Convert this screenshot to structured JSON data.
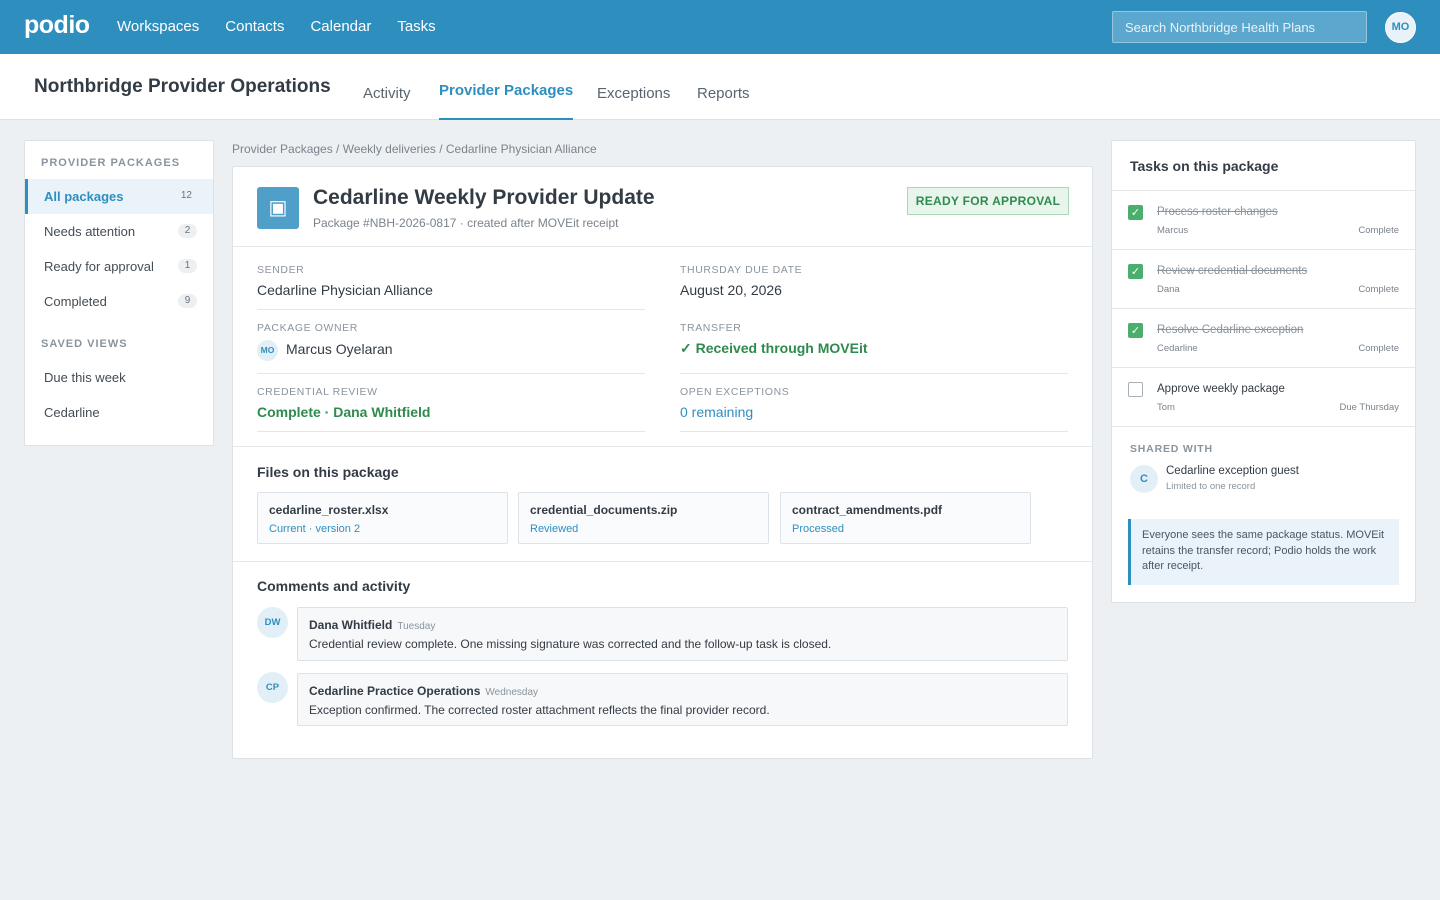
{
  "app": {
    "logo": "podio",
    "nav": [
      "Workspaces",
      "Contacts",
      "Calendar",
      "Tasks"
    ],
    "search_placeholder": "Search Northbridge Health Plans",
    "user_initials": "MO"
  },
  "workspace": {
    "title": "Northbridge Provider Operations",
    "tabs": [
      {
        "label": "Activity",
        "active": false
      },
      {
        "label": "Provider Packages",
        "active": true
      },
      {
        "label": "Exceptions",
        "active": false
      },
      {
        "label": "Reports",
        "active": false
      }
    ]
  },
  "sidebar": {
    "heading": "PROVIDER PACKAGES",
    "items": [
      {
        "label": "All packages",
        "count": "12",
        "active": true
      },
      {
        "label": "Needs attention",
        "count": "2",
        "active": false
      },
      {
        "label": "Ready for approval",
        "count": "1",
        "active": false
      },
      {
        "label": "Completed",
        "count": "9",
        "active": false
      }
    ],
    "saved_heading": "SAVED VIEWS",
    "saved_views": [
      "Due this week",
      "Cedarline"
    ]
  },
  "breadcrumb": "Provider Packages / Weekly deliveries / Cedarline Physician Alliance",
  "package": {
    "icon": "▣",
    "title": "Cedarline Weekly Provider Update",
    "subtitle": "Package #NBH-2026-0817 · created after MOVEit receipt",
    "status": "READY FOR APPROVAL",
    "fields": {
      "sender_label": "SENDER",
      "sender": "Cedarline Physician Alliance",
      "due_label": "THURSDAY DUE DATE",
      "due": "August 20, 2026",
      "owner_label": "PACKAGE OWNER",
      "owner_initials": "MO",
      "owner": "Marcus Oyelaran",
      "transfer_label": "TRANSFER",
      "transfer": "✓ Received through MOVEit",
      "credential_label": "CREDENTIAL REVIEW",
      "credential": "Complete · Dana Whitfield",
      "exceptions_label": "OPEN EXCEPTIONS",
      "exceptions": "0 remaining"
    },
    "files_heading": "Files on this package",
    "files": [
      {
        "name": "cedarline_roster.xlsx",
        "meta": "Current · version 2"
      },
      {
        "name": "credential_documents.zip",
        "meta": "Reviewed"
      },
      {
        "name": "contract_amendments.pdf",
        "meta": "Processed"
      }
    ],
    "comments_heading": "Comments and activity",
    "comments": [
      {
        "initials": "DW",
        "author": "Dana Whitfield",
        "when": "Tuesday",
        "text": "Credential review complete. One missing signature was corrected and the follow-up task is closed."
      },
      {
        "initials": "CP",
        "author": "Cedarline Practice Operations",
        "when": "Wednesday",
        "text": "Exception confirmed. The corrected roster attachment reflects the final provider record."
      }
    ]
  },
  "tasks_panel": {
    "title": "Tasks on this package",
    "tasks": [
      {
        "name": "Process roster changes",
        "assignee": "Marcus",
        "state": "Complete",
        "done": true
      },
      {
        "name": "Review credential documents",
        "assignee": "Dana",
        "state": "Complete",
        "done": true
      },
      {
        "name": "Resolve Cedarline exception",
        "assignee": "Cedarline",
        "state": "Complete",
        "done": true
      },
      {
        "name": "Approve weekly package",
        "assignee": "Tom",
        "state": "Due Thursday",
        "done": false
      }
    ],
    "shared_heading": "SHARED WITH",
    "shared": {
      "initial": "C",
      "name": "Cedarline exception guest",
      "sub": "Limited to one record"
    },
    "note": "Everyone sees the same package status. MOVEit retains the transfer record; Podio holds the work after receipt."
  },
  "colors": {
    "brand": "#2e8fbf",
    "success": "#2f8a4d",
    "checkbox_done": "#4cae6c",
    "background": "#ecf0f3"
  }
}
